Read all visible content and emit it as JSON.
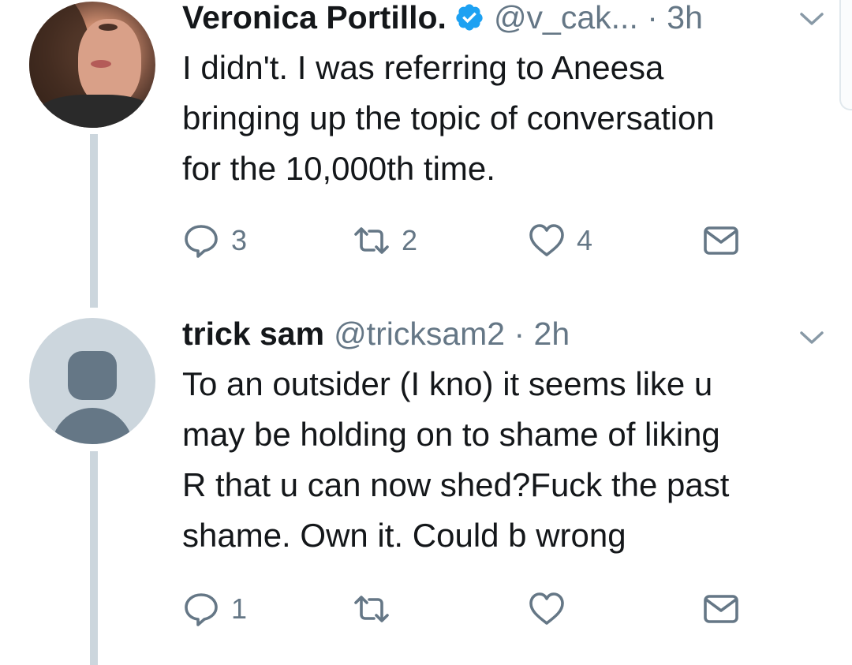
{
  "tweets": [
    {
      "name": "Veronica Portillo.",
      "verified": true,
      "handle": "@v_cak...",
      "separator": " · ",
      "time": "3h",
      "text": "I didn't.  I was referring to Aneesa\nbringing up the topic of conversation\nfor the 10,000th time.",
      "avatar": "profile-photo",
      "actions": {
        "replies": "3",
        "retweets": "2",
        "likes": "4"
      }
    },
    {
      "name": "trick sam",
      "verified": false,
      "handle": "@tricksam2",
      "separator": " · ",
      "time": "2h",
      "text": "To an outsider (I kno) it seems like u\nmay be holding on to shame of liking\nR that u can now shed?Fuck the past\nshame. Own it. Could b wrong",
      "avatar": "default-egg-avatar",
      "actions": {
        "replies": "1",
        "retweets": "",
        "likes": ""
      }
    }
  ],
  "icons": [
    "reply-icon",
    "retweet-icon",
    "like-icon",
    "direct-message-icon",
    "verified-badge-icon",
    "chevron-down-icon"
  ],
  "colors": {
    "verified": "#1da1f2",
    "secondary_text": "#657786",
    "thread_line": "#ccd6dd",
    "primary_text": "#14171a"
  }
}
